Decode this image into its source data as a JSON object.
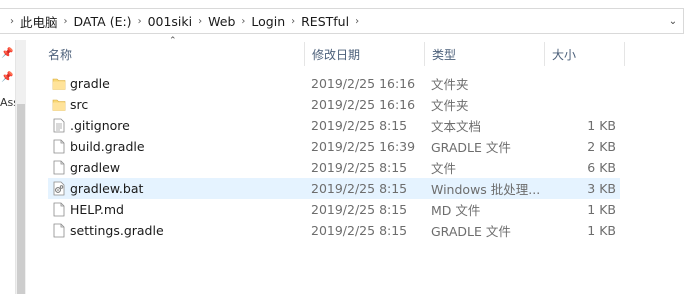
{
  "breadcrumb": [
    "此电脑",
    "DATA (E:)",
    "001siki",
    "Web",
    "Login",
    "RESTful"
  ],
  "nav": {
    "label": "Ass"
  },
  "columns": {
    "name": "名称",
    "modified": "修改日期",
    "type": "类型",
    "size": "大小"
  },
  "files": [
    {
      "name": "gradle",
      "date": "2019/2/25 16:16",
      "type": "文件夹",
      "size": "",
      "icon": "folder-icon",
      "selected": false
    },
    {
      "name": "src",
      "date": "2019/2/25 16:16",
      "type": "文件夹",
      "size": "",
      "icon": "folder-icon",
      "selected": false
    },
    {
      "name": ".gitignore",
      "date": "2019/2/25 8:15",
      "type": "文本文档",
      "size": "1 KB",
      "icon": "text-file-icon",
      "selected": false
    },
    {
      "name": "build.gradle",
      "date": "2019/2/25 16:39",
      "type": "GRADLE 文件",
      "size": "2 KB",
      "icon": "file-icon",
      "selected": false
    },
    {
      "name": "gradlew",
      "date": "2019/2/25 8:15",
      "type": "文件",
      "size": "6 KB",
      "icon": "file-icon",
      "selected": false
    },
    {
      "name": "gradlew.bat",
      "date": "2019/2/25 8:15",
      "type": "Windows 批处理...",
      "size": "3 KB",
      "icon": "batch-file-icon",
      "selected": true
    },
    {
      "name": "HELP.md",
      "date": "2019/2/25 8:15",
      "type": "MD 文件",
      "size": "1 KB",
      "icon": "file-icon",
      "selected": false
    },
    {
      "name": "settings.gradle",
      "date": "2019/2/25 8:15",
      "type": "GRADLE 文件",
      "size": "1 KB",
      "icon": "file-icon",
      "selected": false
    }
  ],
  "colors": {
    "folder": "#f8d775",
    "selection": "#e5f3ff",
    "header_text": "#4c607a"
  }
}
